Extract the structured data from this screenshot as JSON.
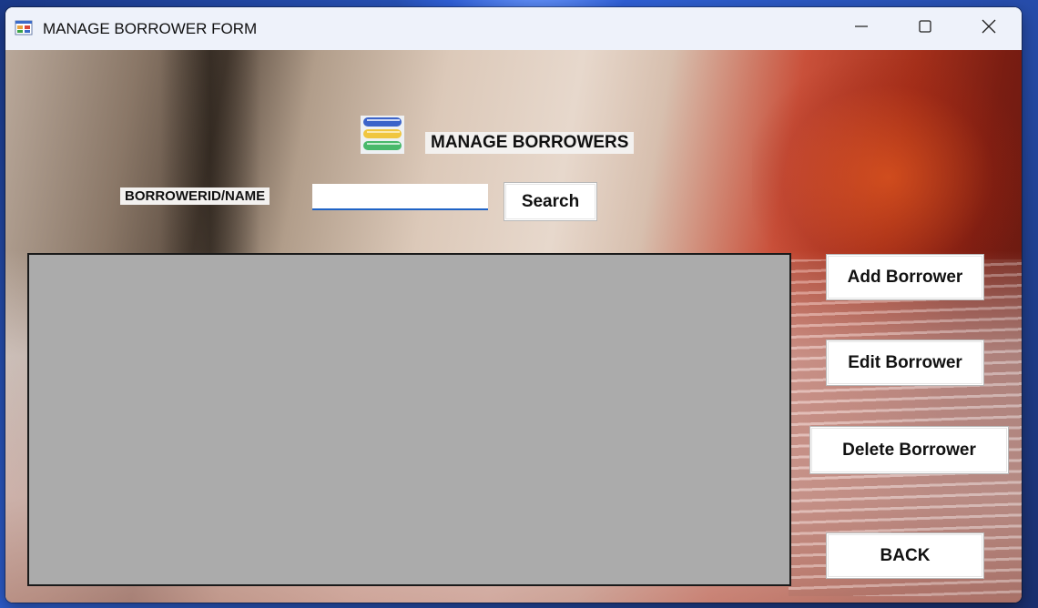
{
  "window": {
    "title": "MANAGE BORROWER FORM"
  },
  "form": {
    "heading": "MANAGE BORROWERS",
    "search": {
      "label": "BORROWERID/NAME",
      "value": "",
      "placeholder": "",
      "button_label": "Search"
    },
    "actions": {
      "add_label": "Add Borrower",
      "edit_label": "Edit Borrower",
      "delete_label": "Delete Borrower",
      "back_label": "BACK"
    },
    "grid": {
      "rows": []
    }
  },
  "icons": {
    "app": "form-app-icon",
    "logo": "books-stack-icon",
    "minimize": "minimize-icon",
    "maximize": "maximize-icon",
    "close": "close-icon"
  },
  "colors": {
    "grid_background": "#ababab",
    "input_underline": "#1f63c6",
    "titlebar": "#eef2fa"
  }
}
